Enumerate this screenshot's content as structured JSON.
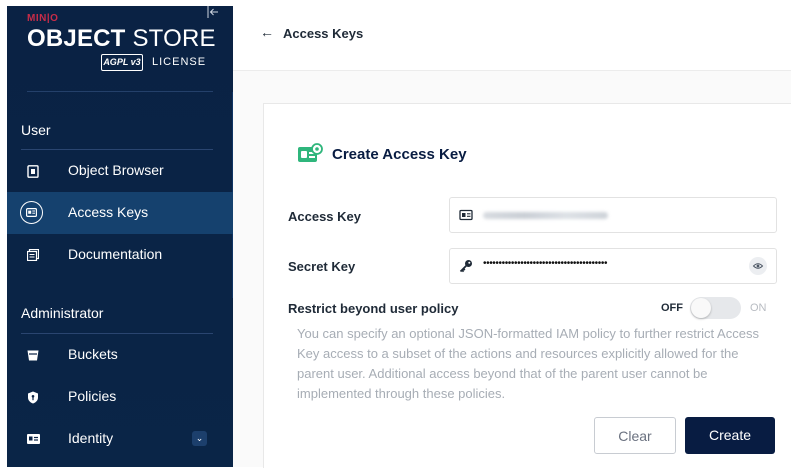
{
  "sidebar": {
    "logo": {
      "brand": "MIN|O",
      "product_bold": "OBJECT",
      "product_rest": "STORE",
      "badge": "AGPL v3",
      "license": "LICENSE"
    },
    "sections": [
      {
        "label": "User"
      },
      {
        "label": "Administrator"
      }
    ],
    "items": [
      {
        "label": "Object Browser",
        "icon": "object-browser-icon"
      },
      {
        "label": "Access Keys",
        "icon": "access-keys-icon",
        "active": true
      },
      {
        "label": "Documentation",
        "icon": "documentation-icon"
      },
      {
        "label": "Buckets",
        "icon": "buckets-icon"
      },
      {
        "label": "Policies",
        "icon": "policies-icon"
      },
      {
        "label": "Identity",
        "icon": "identity-icon",
        "expandable": true
      }
    ]
  },
  "header": {
    "back_icon": "←",
    "title": "Access Keys"
  },
  "form": {
    "title": "Create Access Key",
    "access_key": {
      "label": "Access Key"
    },
    "secret_key": {
      "label": "Secret Key",
      "value": "••••••••••••••••••••••••••••••••••••••••"
    },
    "restrict": {
      "label": "Restrict beyond user policy",
      "off": "OFF",
      "on": "ON",
      "enabled": false,
      "help": "You can specify an optional JSON-formatted IAM policy to further restrict Access Key access to a subset of the actions and resources explicitly allowed for the parent user. Additional access beyond that of the parent user cannot be implemented through these policies."
    },
    "buttons": {
      "clear": "Clear",
      "create": "Create"
    }
  },
  "colors": {
    "sidebar": "#0a2244",
    "active_item": "#15416e",
    "primary": "#081c42",
    "accent_green": "#2fb67c",
    "brand_red": "#c72c48"
  }
}
